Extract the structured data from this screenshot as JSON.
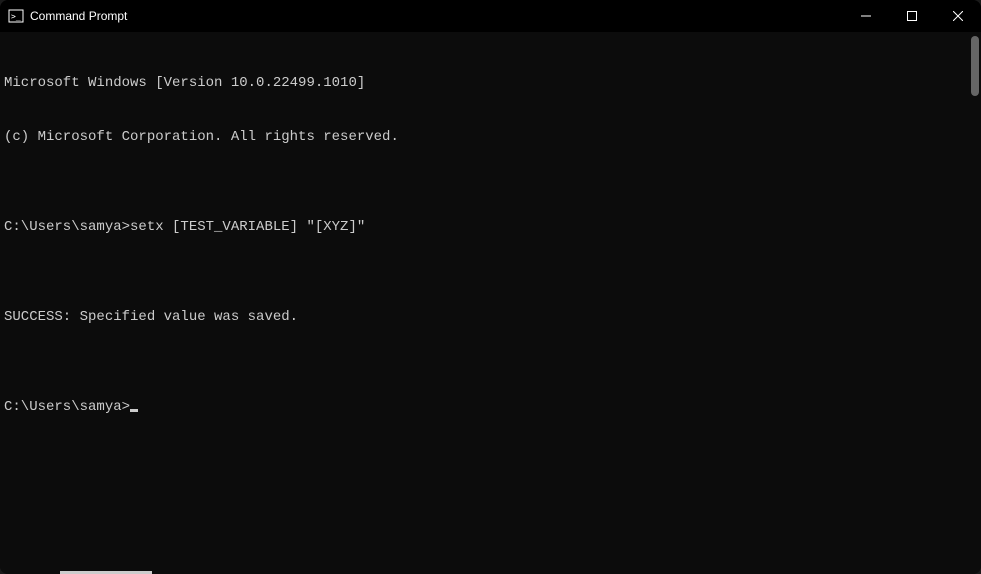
{
  "titlebar": {
    "title": "Command Prompt"
  },
  "terminal": {
    "lines": [
      "Microsoft Windows [Version 10.0.22499.1010]",
      "(c) Microsoft Corporation. All rights reserved.",
      "",
      "C:\\Users\\samya>setx [TEST_VARIABLE] \"[XYZ]\"",
      "",
      "SUCCESS: Specified value was saved.",
      "",
      "C:\\Users\\samya>"
    ]
  }
}
